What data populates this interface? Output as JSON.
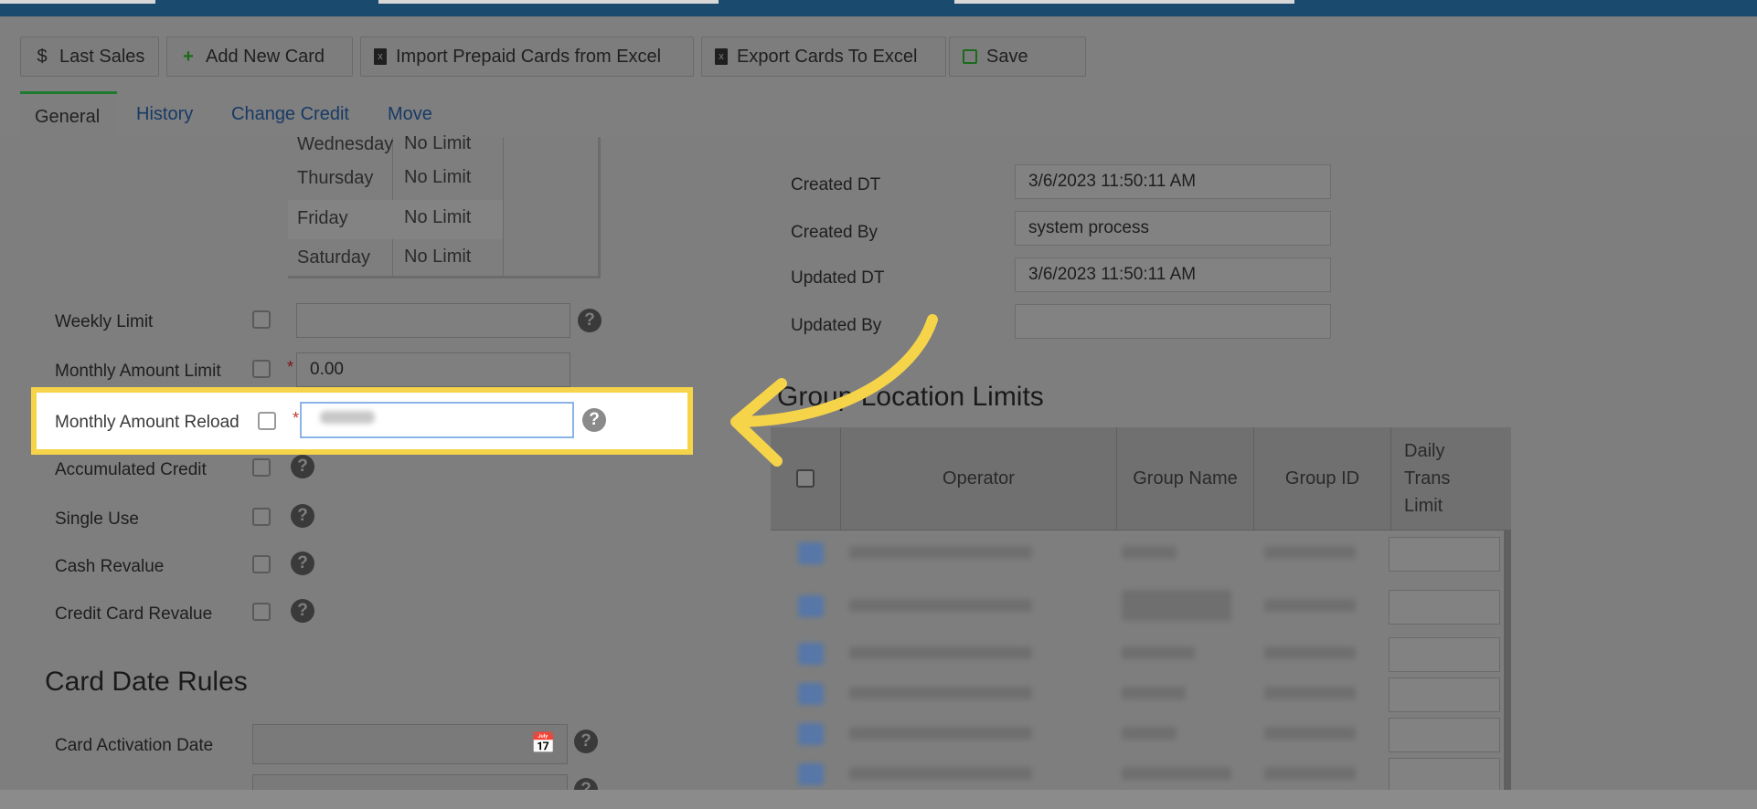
{
  "toolbar": {
    "last_sales": "Last Sales",
    "add_new_card": "Add New Card",
    "import_prepaid": "Import Prepaid Cards from Excel",
    "export_cards": "Export Cards To Excel",
    "save": "Save"
  },
  "tabs": {
    "general": "General",
    "history": "History",
    "change_credit": "Change Credit",
    "move": "Move"
  },
  "days": [
    {
      "day": "Wednesday",
      "limit": "No Limit"
    },
    {
      "day": "Thursday",
      "limit": "No Limit"
    },
    {
      "day": "Friday",
      "limit": "No Limit"
    },
    {
      "day": "Saturday",
      "limit": "No Limit"
    }
  ],
  "limits": {
    "weekly_limit": "Weekly Limit",
    "monthly_amount_limit": "Monthly Amount Limit",
    "monthly_amount_limit_value": "0.00",
    "monthly_amount_reload": "Monthly Amount Reload",
    "accumulated_credit": "Accumulated Credit",
    "single_use": "Single Use",
    "cash_revalue": "Cash Revalue",
    "credit_card_revalue": "Credit Card Revalue"
  },
  "card_date_rules": {
    "title": "Card Date Rules",
    "activation_date": "Card Activation Date"
  },
  "audit": {
    "created_dt_label": "Created DT",
    "created_dt": "3/6/2023 11:50:11 AM",
    "created_by_label": "Created By",
    "created_by": "system process",
    "updated_dt_label": "Updated DT",
    "updated_dt": "3/6/2023 11:50:11 AM",
    "updated_by_label": "Updated By",
    "updated_by": ""
  },
  "group_limits": {
    "title": "Group Location Limits",
    "columns": {
      "operator": "Operator",
      "group_name": "Group Name",
      "group_id": "Group ID",
      "daily_trans_limit": "Daily Trans Limit"
    }
  },
  "colors": {
    "highlight": "#f6d44a",
    "topbar": "#1a4a6e",
    "tab_accent": "#1d7a2f",
    "required": "#c0392b"
  }
}
